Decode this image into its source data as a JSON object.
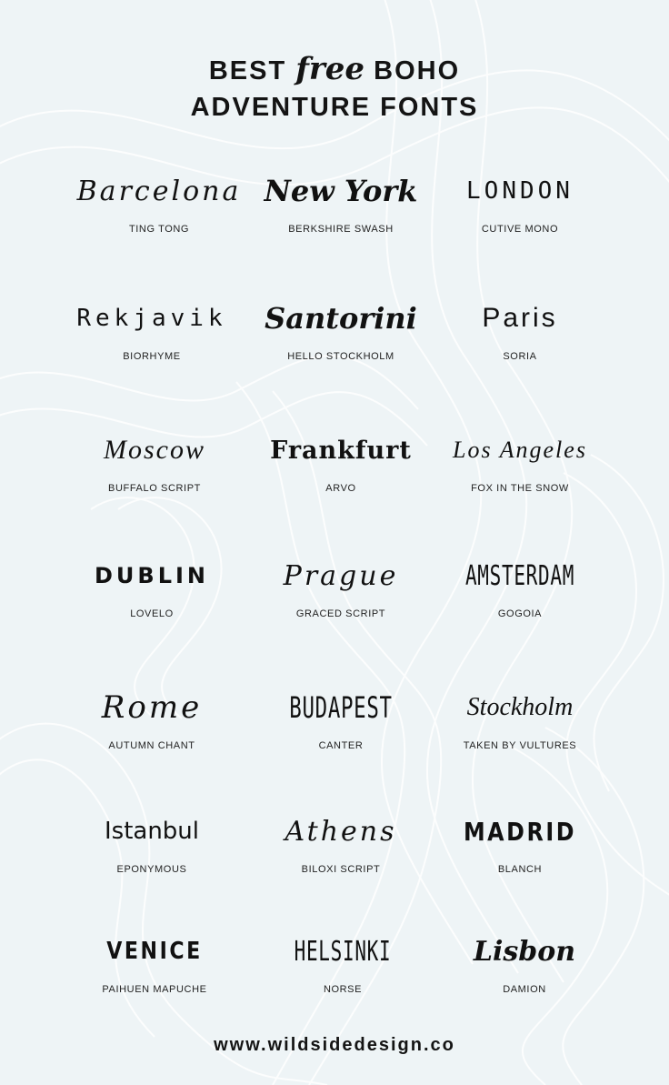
{
  "title": {
    "line1_pre": "BEST",
    "free": "free",
    "line1_post": "BOHO",
    "line2": "ADVENTURE FONTS"
  },
  "fonts": [
    {
      "sample": "Barcelona",
      "label": "TING TONG"
    },
    {
      "sample": "New York",
      "label": "BERKSHIRE SWASH"
    },
    {
      "sample": "LONDON",
      "label": "CUTIVE MONO"
    },
    {
      "sample": "Rekjavik",
      "label": "BIORHYME"
    },
    {
      "sample": "Santorini",
      "label": "HELLO STOCKHOLM"
    },
    {
      "sample": "Paris",
      "label": "SORIA"
    },
    {
      "sample": "Moscow",
      "label": "BUFFALO SCRIPT"
    },
    {
      "sample": "Frankfurt",
      "label": "ARVO"
    },
    {
      "sample": "Los Angeles",
      "label": "FOX IN THE SNOW"
    },
    {
      "sample": "DUBLIN",
      "label": "LOVELO"
    },
    {
      "sample": "Prague",
      "label": "GRACED SCRIPT"
    },
    {
      "sample": "AMSTERDAM",
      "label": "GOGOIA"
    },
    {
      "sample": "Rome",
      "label": "AUTUMN CHANT"
    },
    {
      "sample": "BUDAPEST",
      "label": "CANTER"
    },
    {
      "sample": "Stockholm",
      "label": "TAKEN BY VULTURES"
    },
    {
      "sample": "Istanbul",
      "label": "EPONYMOUS"
    },
    {
      "sample": "Athens",
      "label": "BILOXI SCRIPT"
    },
    {
      "sample": "MADRID",
      "label": "BLANCH"
    },
    {
      "sample": "VENICE",
      "label": "PAIHUEN MAPUCHE"
    },
    {
      "sample": "HELSINKI",
      "label": "NORSE"
    },
    {
      "sample": "Lisbon",
      "label": "DAMION"
    }
  ],
  "footer": "www.wildsidedesign.co",
  "colors": {
    "background": "#eef4f6",
    "contour": "#ffffff",
    "text": "#141414"
  }
}
